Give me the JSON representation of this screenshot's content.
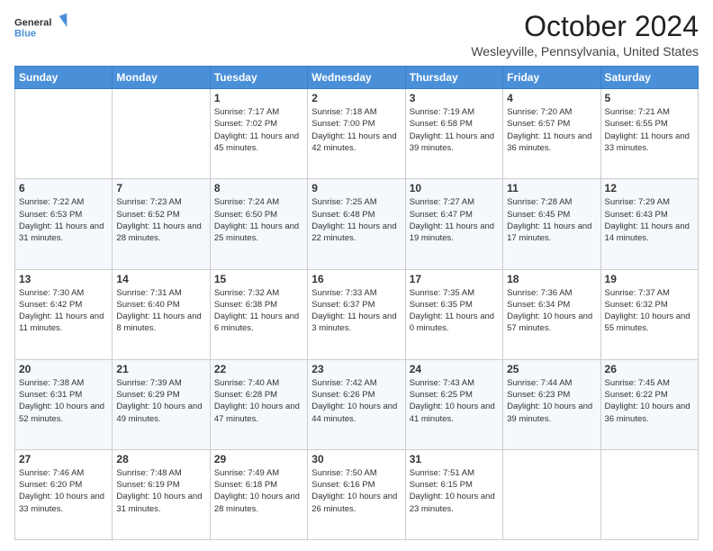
{
  "header": {
    "logo_line1": "General",
    "logo_line2": "Blue",
    "month_title": "October 2024",
    "location": "Wesleyville, Pennsylvania, United States"
  },
  "weekdays": [
    "Sunday",
    "Monday",
    "Tuesday",
    "Wednesday",
    "Thursday",
    "Friday",
    "Saturday"
  ],
  "weeks": [
    [
      {
        "day": "",
        "sunrise": "",
        "sunset": "",
        "daylight": ""
      },
      {
        "day": "",
        "sunrise": "",
        "sunset": "",
        "daylight": ""
      },
      {
        "day": "1",
        "sunrise": "Sunrise: 7:17 AM",
        "sunset": "Sunset: 7:02 PM",
        "daylight": "Daylight: 11 hours and 45 minutes."
      },
      {
        "day": "2",
        "sunrise": "Sunrise: 7:18 AM",
        "sunset": "Sunset: 7:00 PM",
        "daylight": "Daylight: 11 hours and 42 minutes."
      },
      {
        "day": "3",
        "sunrise": "Sunrise: 7:19 AM",
        "sunset": "Sunset: 6:58 PM",
        "daylight": "Daylight: 11 hours and 39 minutes."
      },
      {
        "day": "4",
        "sunrise": "Sunrise: 7:20 AM",
        "sunset": "Sunset: 6:57 PM",
        "daylight": "Daylight: 11 hours and 36 minutes."
      },
      {
        "day": "5",
        "sunrise": "Sunrise: 7:21 AM",
        "sunset": "Sunset: 6:55 PM",
        "daylight": "Daylight: 11 hours and 33 minutes."
      }
    ],
    [
      {
        "day": "6",
        "sunrise": "Sunrise: 7:22 AM",
        "sunset": "Sunset: 6:53 PM",
        "daylight": "Daylight: 11 hours and 31 minutes."
      },
      {
        "day": "7",
        "sunrise": "Sunrise: 7:23 AM",
        "sunset": "Sunset: 6:52 PM",
        "daylight": "Daylight: 11 hours and 28 minutes."
      },
      {
        "day": "8",
        "sunrise": "Sunrise: 7:24 AM",
        "sunset": "Sunset: 6:50 PM",
        "daylight": "Daylight: 11 hours and 25 minutes."
      },
      {
        "day": "9",
        "sunrise": "Sunrise: 7:25 AM",
        "sunset": "Sunset: 6:48 PM",
        "daylight": "Daylight: 11 hours and 22 minutes."
      },
      {
        "day": "10",
        "sunrise": "Sunrise: 7:27 AM",
        "sunset": "Sunset: 6:47 PM",
        "daylight": "Daylight: 11 hours and 19 minutes."
      },
      {
        "day": "11",
        "sunrise": "Sunrise: 7:28 AM",
        "sunset": "Sunset: 6:45 PM",
        "daylight": "Daylight: 11 hours and 17 minutes."
      },
      {
        "day": "12",
        "sunrise": "Sunrise: 7:29 AM",
        "sunset": "Sunset: 6:43 PM",
        "daylight": "Daylight: 11 hours and 14 minutes."
      }
    ],
    [
      {
        "day": "13",
        "sunrise": "Sunrise: 7:30 AM",
        "sunset": "Sunset: 6:42 PM",
        "daylight": "Daylight: 11 hours and 11 minutes."
      },
      {
        "day": "14",
        "sunrise": "Sunrise: 7:31 AM",
        "sunset": "Sunset: 6:40 PM",
        "daylight": "Daylight: 11 hours and 8 minutes."
      },
      {
        "day": "15",
        "sunrise": "Sunrise: 7:32 AM",
        "sunset": "Sunset: 6:38 PM",
        "daylight": "Daylight: 11 hours and 6 minutes."
      },
      {
        "day": "16",
        "sunrise": "Sunrise: 7:33 AM",
        "sunset": "Sunset: 6:37 PM",
        "daylight": "Daylight: 11 hours and 3 minutes."
      },
      {
        "day": "17",
        "sunrise": "Sunrise: 7:35 AM",
        "sunset": "Sunset: 6:35 PM",
        "daylight": "Daylight: 11 hours and 0 minutes."
      },
      {
        "day": "18",
        "sunrise": "Sunrise: 7:36 AM",
        "sunset": "Sunset: 6:34 PM",
        "daylight": "Daylight: 10 hours and 57 minutes."
      },
      {
        "day": "19",
        "sunrise": "Sunrise: 7:37 AM",
        "sunset": "Sunset: 6:32 PM",
        "daylight": "Daylight: 10 hours and 55 minutes."
      }
    ],
    [
      {
        "day": "20",
        "sunrise": "Sunrise: 7:38 AM",
        "sunset": "Sunset: 6:31 PM",
        "daylight": "Daylight: 10 hours and 52 minutes."
      },
      {
        "day": "21",
        "sunrise": "Sunrise: 7:39 AM",
        "sunset": "Sunset: 6:29 PM",
        "daylight": "Daylight: 10 hours and 49 minutes."
      },
      {
        "day": "22",
        "sunrise": "Sunrise: 7:40 AM",
        "sunset": "Sunset: 6:28 PM",
        "daylight": "Daylight: 10 hours and 47 minutes."
      },
      {
        "day": "23",
        "sunrise": "Sunrise: 7:42 AM",
        "sunset": "Sunset: 6:26 PM",
        "daylight": "Daylight: 10 hours and 44 minutes."
      },
      {
        "day": "24",
        "sunrise": "Sunrise: 7:43 AM",
        "sunset": "Sunset: 6:25 PM",
        "daylight": "Daylight: 10 hours and 41 minutes."
      },
      {
        "day": "25",
        "sunrise": "Sunrise: 7:44 AM",
        "sunset": "Sunset: 6:23 PM",
        "daylight": "Daylight: 10 hours and 39 minutes."
      },
      {
        "day": "26",
        "sunrise": "Sunrise: 7:45 AM",
        "sunset": "Sunset: 6:22 PM",
        "daylight": "Daylight: 10 hours and 36 minutes."
      }
    ],
    [
      {
        "day": "27",
        "sunrise": "Sunrise: 7:46 AM",
        "sunset": "Sunset: 6:20 PM",
        "daylight": "Daylight: 10 hours and 33 minutes."
      },
      {
        "day": "28",
        "sunrise": "Sunrise: 7:48 AM",
        "sunset": "Sunset: 6:19 PM",
        "daylight": "Daylight: 10 hours and 31 minutes."
      },
      {
        "day": "29",
        "sunrise": "Sunrise: 7:49 AM",
        "sunset": "Sunset: 6:18 PM",
        "daylight": "Daylight: 10 hours and 28 minutes."
      },
      {
        "day": "30",
        "sunrise": "Sunrise: 7:50 AM",
        "sunset": "Sunset: 6:16 PM",
        "daylight": "Daylight: 10 hours and 26 minutes."
      },
      {
        "day": "31",
        "sunrise": "Sunrise: 7:51 AM",
        "sunset": "Sunset: 6:15 PM",
        "daylight": "Daylight: 10 hours and 23 minutes."
      },
      {
        "day": "",
        "sunrise": "",
        "sunset": "",
        "daylight": ""
      },
      {
        "day": "",
        "sunrise": "",
        "sunset": "",
        "daylight": ""
      }
    ]
  ]
}
